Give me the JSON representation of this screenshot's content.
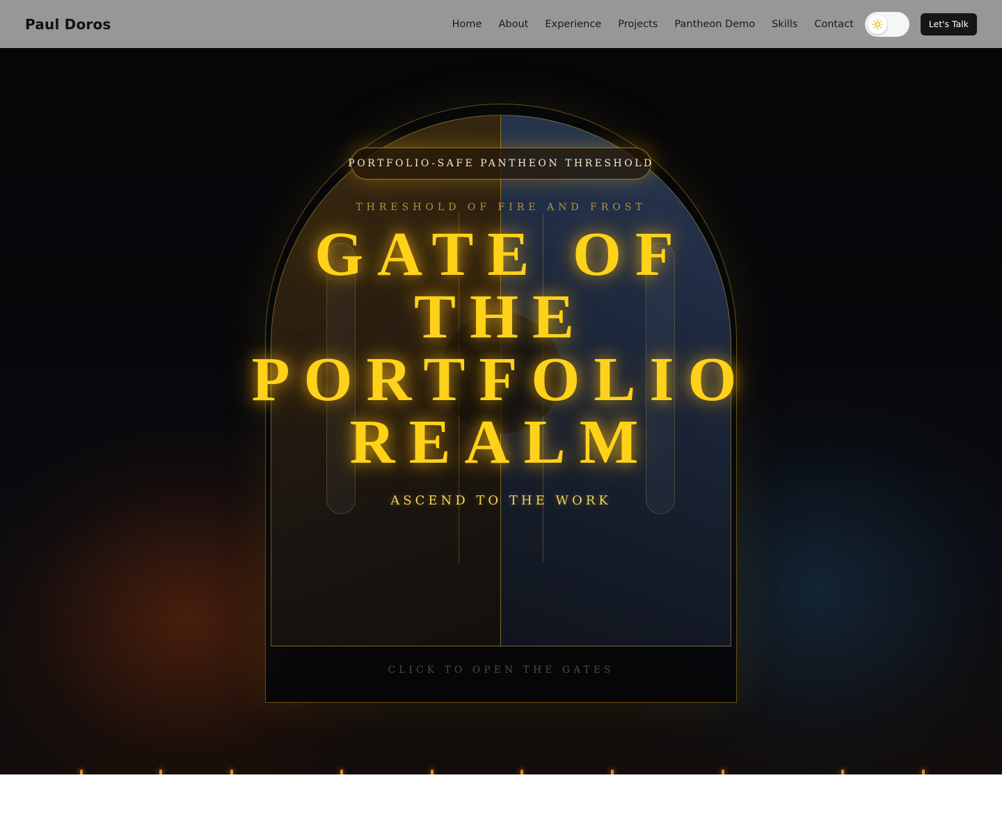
{
  "header": {
    "brand": "Paul Doros",
    "nav": [
      "Home",
      "About",
      "Experience",
      "Projects",
      "Pantheon Demo",
      "Skills",
      "Contact"
    ],
    "theme_toggle": {
      "icon": "sun-icon",
      "state": "light"
    },
    "cta_label": "Let's Talk"
  },
  "hero": {
    "pill": "PORTFOLIO-SAFE PANTHEON THRESHOLD",
    "tagline": "THRESHOLD OF FIRE AND FROST",
    "title_lines": [
      "GATE OF",
      "THE",
      "PORTFOLIO",
      "REALM"
    ],
    "subtitle": "ASCEND TO THE WORK",
    "hint": "CLICK TO OPEN THE GATES"
  },
  "colors": {
    "header_bg": "#979797",
    "title_gold": "#ffd21a",
    "cta_bg": "#161616"
  }
}
